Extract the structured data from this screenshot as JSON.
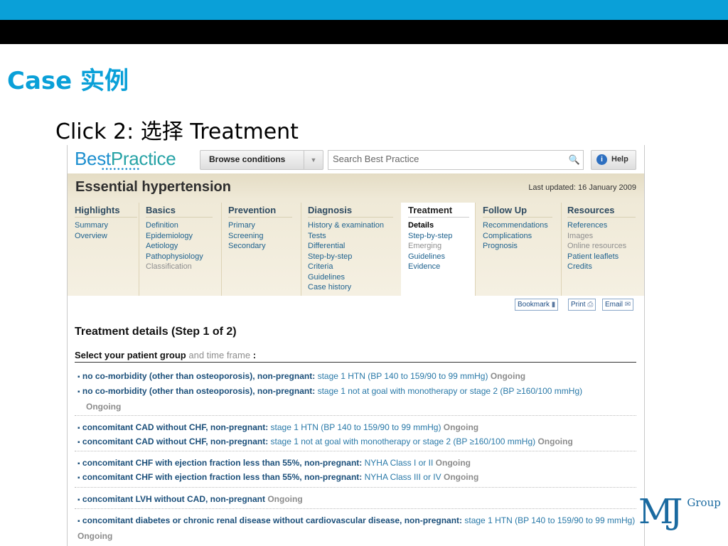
{
  "slide": {
    "title": "Case 实例",
    "subtitle": "Click 2: 选择 Treatment",
    "brand_mj": "MJ",
    "brand_group": "Group"
  },
  "app": {
    "logo_best": "Best",
    "logo_practice": "Practice",
    "logo_dots": "••••••••••",
    "browse_label": "Browse conditions",
    "browse_arrow_icon": "dropdown-arrow",
    "search_placeholder": "Search Best Practice",
    "search_icon": "magnifier",
    "help_label": "Help",
    "help_icon": "info-circle"
  },
  "condition": {
    "title": "Essential hypertension",
    "updated": "Last updated: 16 January 2009"
  },
  "nav": [
    {
      "heading": "Highlights",
      "links": [
        {
          "t": "Summary"
        },
        {
          "t": "Overview"
        }
      ]
    },
    {
      "heading": "Basics",
      "links": [
        {
          "t": "Definition"
        },
        {
          "t": "Epidemiology"
        },
        {
          "t": "Aetiology"
        },
        {
          "t": "Pathophysiology"
        },
        {
          "t": "Classification",
          "disabled": true
        }
      ]
    },
    {
      "heading": "Prevention",
      "links": [
        {
          "t": "Primary"
        },
        {
          "t": "Screening"
        },
        {
          "t": "Secondary"
        }
      ]
    },
    {
      "heading": "Diagnosis",
      "links": [
        {
          "t": "History & examination"
        },
        {
          "t": "Tests"
        },
        {
          "t": "Differential"
        },
        {
          "t": "Step-by-step"
        },
        {
          "t": "Criteria"
        },
        {
          "t": "Guidelines"
        },
        {
          "t": "Case history"
        }
      ]
    },
    {
      "heading": "Treatment",
      "active": true,
      "links": [
        {
          "t": "Details",
          "current": true
        },
        {
          "t": "Step-by-step"
        },
        {
          "t": "Emerging",
          "disabled": true
        },
        {
          "t": "Guidelines"
        },
        {
          "t": "Evidence"
        }
      ]
    },
    {
      "heading": "Follow Up",
      "links": [
        {
          "t": "Recommendations"
        },
        {
          "t": "Complications"
        },
        {
          "t": "Prognosis"
        }
      ]
    },
    {
      "heading": "Resources",
      "links": [
        {
          "t": "References"
        },
        {
          "t": "Images",
          "disabled": true
        },
        {
          "t": "Online resources",
          "disabled": true
        },
        {
          "t": "Patient leaflets"
        },
        {
          "t": "Credits"
        }
      ]
    }
  ],
  "tools": {
    "bookmark": "Bookmark",
    "print": "Print",
    "email": "Email"
  },
  "treatment": {
    "title": "Treatment details (Step 1 of 2)",
    "group_label": "Select your patient group",
    "group_light": "and time frame",
    "group_colon": ":",
    "options": [
      {
        "bold": "no co-morbidity (other than osteoporosis), non-pregnant:",
        "stage": "stage 1 HTN (BP 140 to 159/90 to 99 mmHg)",
        "time": "Ongoing"
      },
      {
        "bold": "no co-morbidity (other than osteoporosis), non-pregnant:",
        "stage": "stage 1 not at goal with monotherapy or stage 2 (BP ≥160/100 mmHg)",
        "time": "Ongoing"
      },
      {
        "bold": "concomitant CAD without CHF, non-pregnant:",
        "stage": "stage 1 HTN (BP 140 to 159/90 to 99 mmHg)",
        "time": "Ongoing"
      },
      {
        "bold": "concomitant CAD without CHF, non-pregnant:",
        "stage": "stage 1 not at goal with monotherapy or stage 2 (BP ≥160/100 mmHg)",
        "time": "Ongoing"
      },
      {
        "bold": "concomitant CHF with ejection fraction less than 55%, non-pregnant:",
        "stage": "NYHA Class I or II",
        "time": "Ongoing"
      },
      {
        "bold": "concomitant CHF with ejection fraction less than 55%, non-pregnant:",
        "stage": "NYHA Class III or IV",
        "time": "Ongoing"
      },
      {
        "bold": "concomitant LVH without CAD, non-pregnant",
        "stage": "",
        "time": "Ongoing"
      },
      {
        "bold": "concomitant diabetes or chronic renal disease without cardiovascular disease, non-pregnant:",
        "stage": "stage 1 HTN (BP 140 to 159/90 to 99 mmHg)",
        "time": "Ongoing"
      }
    ]
  }
}
